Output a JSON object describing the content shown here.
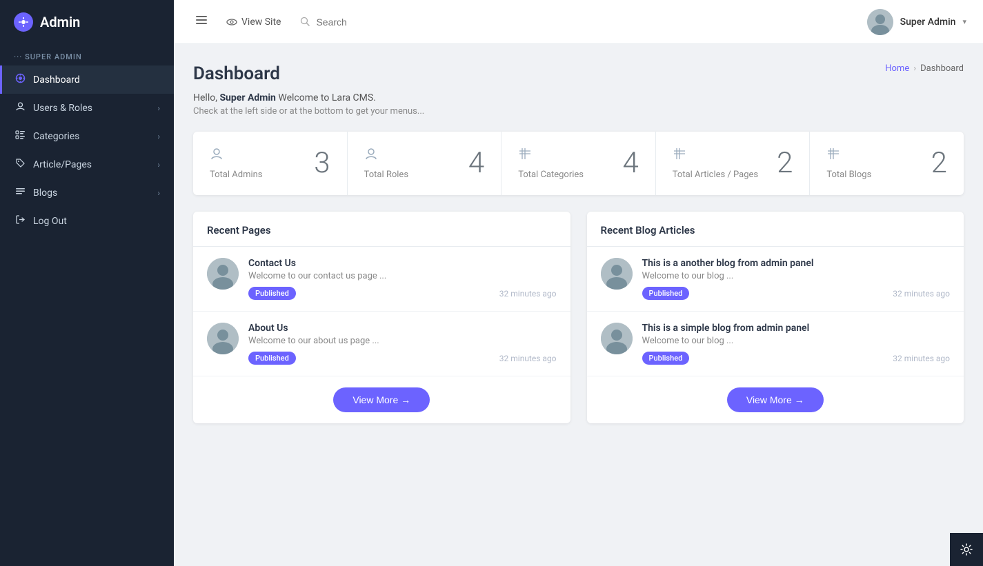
{
  "brand": {
    "icon": "✦",
    "title": "Admin"
  },
  "sidebar": {
    "section_label": "··· SUPER ADMIN",
    "items": [
      {
        "id": "dashboard",
        "label": "Dashboard",
        "icon": "✦",
        "active": true,
        "has_chevron": false
      },
      {
        "id": "users-roles",
        "label": "Users & Roles",
        "icon": "👤",
        "active": false,
        "has_chevron": true
      },
      {
        "id": "categories",
        "label": "Categories",
        "icon": "≡",
        "active": false,
        "has_chevron": true
      },
      {
        "id": "article-pages",
        "label": "Article/Pages",
        "icon": "🏷",
        "active": false,
        "has_chevron": true
      },
      {
        "id": "blogs",
        "label": "Blogs",
        "icon": "☰",
        "active": false,
        "has_chevron": true
      },
      {
        "id": "logout",
        "label": "Log Out",
        "icon": "◇",
        "active": false,
        "has_chevron": false
      }
    ]
  },
  "topbar": {
    "view_site_label": "View Site",
    "search_placeholder": "Search",
    "user_name": "Super Admin"
  },
  "page": {
    "title": "Dashboard",
    "breadcrumb_home": "Home",
    "breadcrumb_current": "Dashboard",
    "welcome_line1_prefix": "Hello, ",
    "welcome_name": "Super Admin",
    "welcome_line1_suffix": " Welcome to Lara CMS.",
    "welcome_line2": "Check at the left side or at the bottom to get your menus..."
  },
  "stats": [
    {
      "id": "admins",
      "label": "Total Admins",
      "value": "3"
    },
    {
      "id": "roles",
      "label": "Total Roles",
      "value": "4"
    },
    {
      "id": "categories",
      "label": "Total Categories",
      "value": "4"
    },
    {
      "id": "articles",
      "label": "Total Articles / Pages",
      "value": "2"
    },
    {
      "id": "blogs",
      "label": "Total Blogs",
      "value": "2"
    }
  ],
  "recent_pages": {
    "title": "Recent Pages",
    "items": [
      {
        "id": "contact-us",
        "title": "Contact Us",
        "desc": "Welcome to our contact us page ...",
        "status": "Published",
        "time": "32 minutes ago"
      },
      {
        "id": "about-us",
        "title": "About Us",
        "desc": "Welcome to our about us page ...",
        "status": "Published",
        "time": "32 minutes ago"
      }
    ],
    "view_more": "View More →"
  },
  "recent_blogs": {
    "title": "Recent Blog Articles",
    "items": [
      {
        "id": "blog-another",
        "title": "This is a another blog from admin panel",
        "desc": "Welcome to our blog ...",
        "status": "Published",
        "time": "32 minutes ago"
      },
      {
        "id": "blog-simple",
        "title": "This is a simple blog from admin panel",
        "desc": "Welcome to our blog ...",
        "status": "Published",
        "time": "32 minutes ago"
      }
    ],
    "view_more": "View More →"
  },
  "colors": {
    "accent": "#6c63ff",
    "sidebar_bg": "#1a2332"
  }
}
